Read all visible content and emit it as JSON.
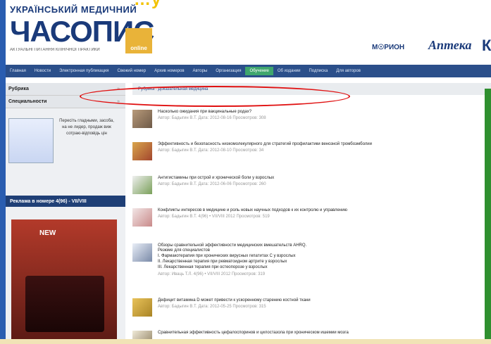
{
  "slide_title": "…у",
  "header": {
    "logo_top": "УКРАЇНСЬКИЙ МЕДИЧНИЙ",
    "logo_main": "ЧАСОПИС",
    "logo_sub": "АКТУАЛЬНІ ПИТАННЯ КЛІНІЧНОЇ ПРАКТИКИ",
    "logo_online": "online",
    "partner1": "М☉РИОН",
    "partner2": "Аптека",
    "partner3": "К"
  },
  "nav": {
    "items": [
      "Главная",
      "Новости",
      "Электронная публикация",
      "Свежий номер",
      "Архив номеров",
      "Авторы",
      "Организация",
      "Обучение",
      "Об издании",
      "Подписка",
      "Для авторов"
    ],
    "active_index": 7
  },
  "sidebar": {
    "rubric_label": "Рубрика",
    "specialty_label": "Специальности",
    "ad_text": "Пересіть гладными, засоба, на не лидер, продаж виж сотраю-відповідь цін",
    "issue_label": "Реклама в номере 4(96) - VII/VIII",
    "cover_title": "NEW"
  },
  "content": {
    "rubric_text": "Рубрика :  Доказательная медицина",
    "articles": [
      {
        "title": "Насколько ожидания при вакцинальные родах?",
        "meta": "Автор: Бадыгин В.Т. Дата: 2012-08-16 Просмотров: 308",
        "extra": []
      },
      {
        "title": "Эффективность и безопасность низкомолекулярного для стратегий профилактики венозной тромбоэмболии",
        "meta": "Автор: Бадыгин В.Т. Дата: 2012-08-10 Просмотров: 34",
        "extra": []
      },
      {
        "title": "Антигистамины при острой и хронической боли у взрослых",
        "meta": "Автор: Бадыгин В.Т. Дата: 2012-06-06 Просмотров: 260",
        "extra": []
      },
      {
        "title": "Конфликты интересов в медицине и роль новых научных подходов к их контролю и управлению",
        "meta": "Автор: Бадыгин В.Т. 4(96) • VII/VIII 2012 Просмотров: 519",
        "extra": []
      },
      {
        "title": "Обзоры сравнительной эффективности медицинских вмешательств AHRQ.",
        "meta": "Автор: Иваць Т.Л. 4(96) • VII/VIII 2012 Просмотров: 319",
        "extra": [
          "Резюме для специалистов",
          "I. Фармакотерапия при хронических вирусных гепатитах С у взрослых",
          "II. Лекарственная терапия при ревматоидном артрите у взрослых",
          "III. Лекарственная терапия при остеопорозе у взрослых"
        ]
      },
      {
        "title": "Дефицит витамина D может привести к ускоренному старению костной ткани",
        "meta": "Автор: Бадыгин В.Т. Дата: 2012-05-25 Просмотров: 315",
        "extra": []
      },
      {
        "title": "Сравнительная эффективность цефалоспоринов и цилостазола при хроническом ишемии мозга",
        "meta": "",
        "extra": []
      }
    ]
  },
  "colors": {
    "frame": "#2a5db0",
    "nav": "#2b4f8a",
    "active": "#3fa66d",
    "accent": "#e9b339",
    "highlight": "#e01010"
  }
}
